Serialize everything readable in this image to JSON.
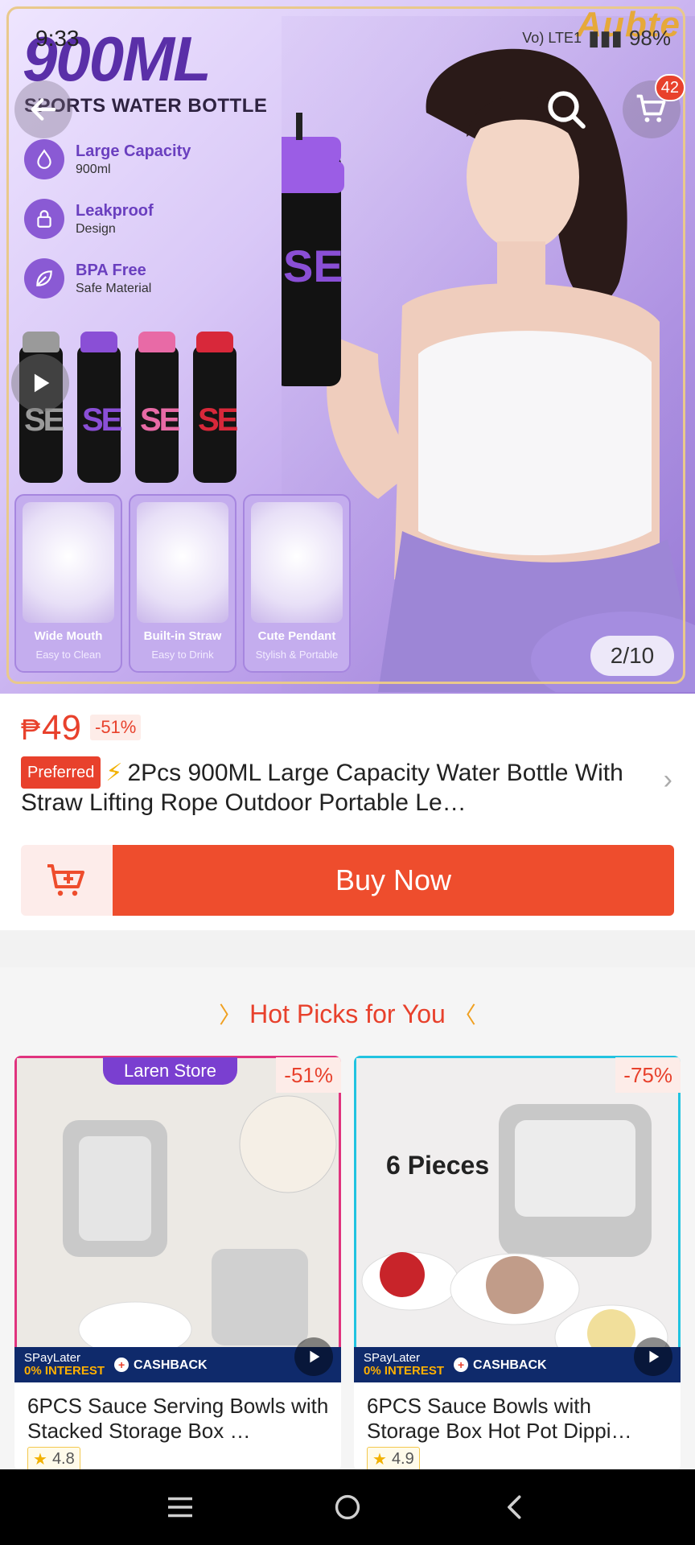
{
  "status_bar": {
    "time": "9:33",
    "right_text": "Vo) LTE1",
    "battery": "98%"
  },
  "hero": {
    "brand": "Aubte",
    "headline": "900ML",
    "subheadline": "SPORTS WATER BOTTLE",
    "features": [
      {
        "title": "Large Capacity",
        "sub": "900ml",
        "icon": "droplet-icon"
      },
      {
        "title": "Leakproof",
        "sub": "Design",
        "icon": "lock-icon"
      },
      {
        "title": "BPA Free",
        "sub": "Safe Material",
        "icon": "leaf-icon"
      }
    ],
    "bottle_colors": [
      "#9a9a9a",
      "#8a4fd6",
      "#e86aa6",
      "#d8283a"
    ],
    "tiles": [
      {
        "title": "Wide Mouth",
        "sub": "Easy to Clean"
      },
      {
        "title": "Built-in Straw",
        "sub": "Easy to Drink"
      },
      {
        "title": "Cute Pendant",
        "sub": "Stylish & Portable"
      }
    ],
    "image_counter": "2/10",
    "cart_count": "42"
  },
  "product": {
    "currency": "₱",
    "price": "49",
    "discount": "-51%",
    "preferred_label": "Preferred",
    "title": "2Pcs 900ML Large Capacity Water Bottle With Straw Lifting Rope Outdoor Portable Le…",
    "buy_now_label": "Buy Now"
  },
  "hot_picks": {
    "title": "Hot Picks for You",
    "cards": [
      {
        "store_label": "Laren Store",
        "discount": "-51%",
        "spay_line1": "SPayLater",
        "spay_line2": "0% INTEREST",
        "cashback": "CASHBACK",
        "name": "6PCS Sauce Serving Bowls with Stacked Storage Box …",
        "rating": "4.8"
      },
      {
        "discount": "-75%",
        "image_caption": "6 Pieces",
        "spay_line1": "SPayLater",
        "spay_line2": "0% INTEREST",
        "cashback": "CASHBACK",
        "name": "6PCS Sauce Bowls with Storage Box Hot Pot Dippi…",
        "rating": "4.9"
      }
    ]
  },
  "colors": {
    "accent": "#ee4d2d",
    "purple": "#7a3fd0"
  }
}
